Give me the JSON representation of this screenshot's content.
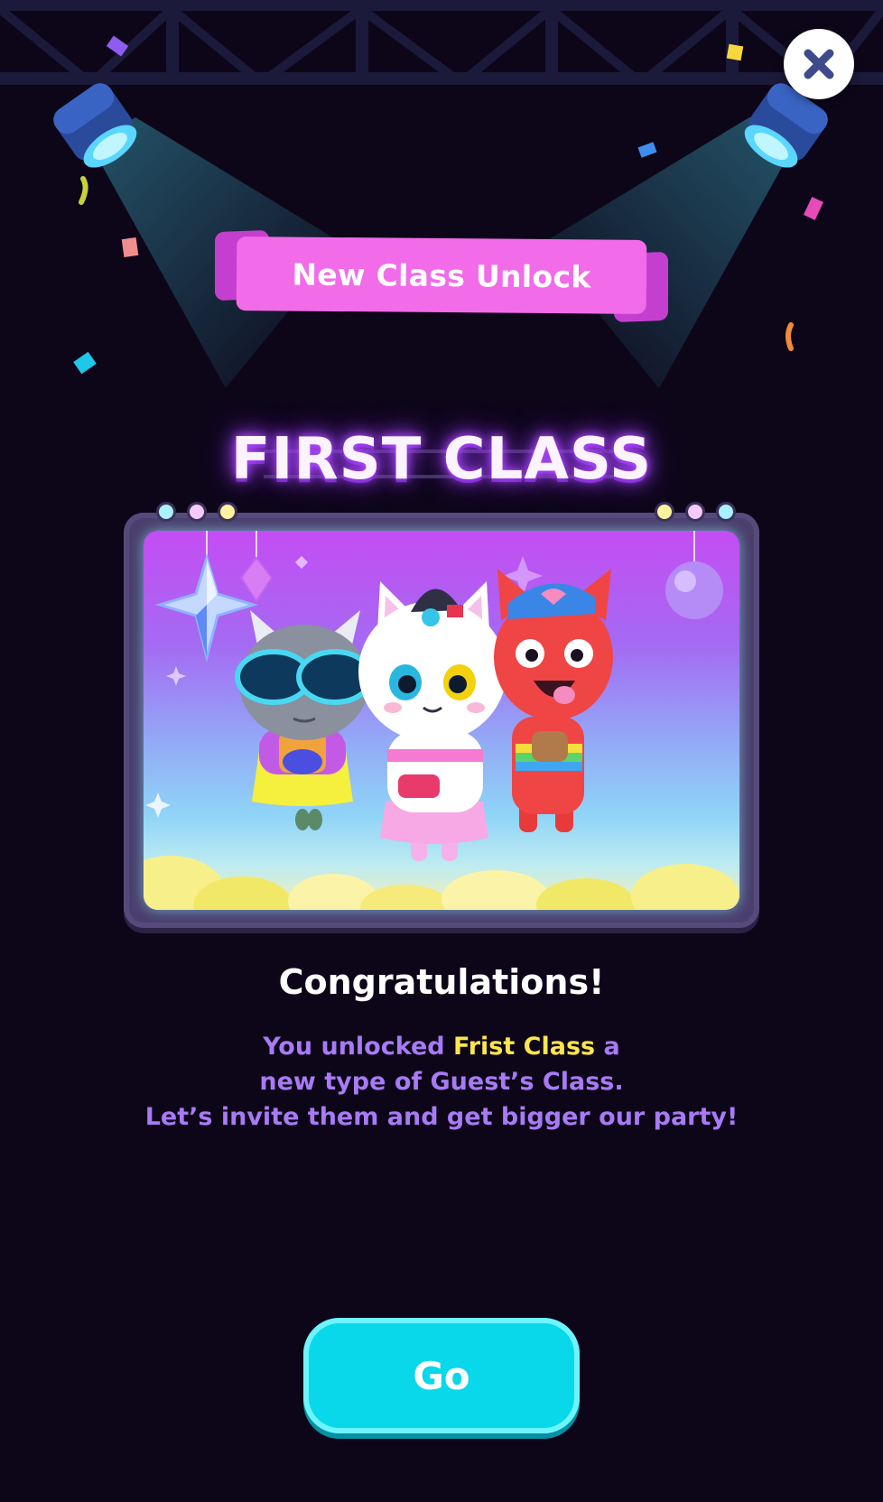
{
  "banner": {
    "label": "New Class Unlock"
  },
  "title": "FIRST CLASS",
  "congrats": "Congratulations!",
  "message": {
    "line1_prefix": "You unlocked ",
    "line1_highlight": "Frist Class",
    "line1_suffix": " a",
    "line2": "new type of Guest’s Class.",
    "line3": "Let’s invite them and get bigger our party!"
  },
  "go_button": {
    "label": "Go"
  },
  "icons": {
    "close": "close-icon",
    "spotlight": "spotlight-icon",
    "confetti": "confetti"
  },
  "colors": {
    "background": "#0d0619",
    "banner": "#f26be8",
    "title_glow": "#b34cff",
    "highlight": "#fce54d",
    "message": "#a87af5",
    "go_button": "#08d8ea",
    "close_x": "#3d4a8c"
  }
}
